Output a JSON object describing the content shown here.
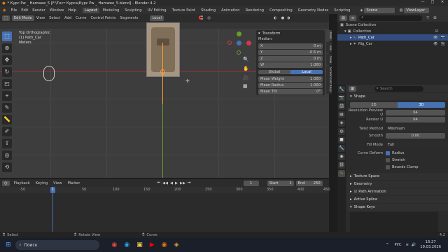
{
  "titlebar": {
    "title": "* Курс Pw _ Hamwee_5 [F:\\Тест Курса\\Курс Pw _ Hamwee_5.blend] - Blender 4.2"
  },
  "menubar": {
    "menus": [
      "File",
      "Edit",
      "Render",
      "Window",
      "Help"
    ],
    "workspaces": [
      "Layout",
      "Modeling",
      "Sculpting",
      "UV Editing",
      "Texture Paint",
      "Shading",
      "Animation",
      "Rendering",
      "Compositing",
      "Geometry Nodes",
      "Scripting"
    ],
    "scene": "Scene",
    "view_layer": "ViewLayer"
  },
  "vheader": {
    "mode": "Edit Mode",
    "menus": [
      "View",
      "Select",
      "Add",
      "Curve",
      "Control Points",
      "Segments"
    ],
    "orientation": "Local"
  },
  "viewport": {
    "view_name": "Top Orthographic",
    "object": "(1) Path_Car",
    "units": "Meters"
  },
  "npanel": {
    "title": "Transform",
    "median_label": "Median:",
    "fields": [
      {
        "label": "X",
        "value": "0 m"
      },
      {
        "label": "Y",
        "value": "-0.5 m"
      },
      {
        "label": "Z",
        "value": "0 m"
      },
      {
        "label": "W",
        "value": "1.000"
      }
    ],
    "global": "Global",
    "local": "Local",
    "extra": [
      {
        "label": "Mean Weight",
        "value": "1.000"
      },
      {
        "label": "Mean Radius",
        "value": "1.000"
      },
      {
        "label": "Mean Tilt",
        "value": "0°"
      }
    ],
    "tabs": [
      "Item",
      "Tool",
      "View",
      "Screencast Keys"
    ]
  },
  "timeline": {
    "menus": [
      "Playback",
      "Keying",
      "View",
      "Marker"
    ],
    "current": "1",
    "start_label": "Start",
    "start": "1",
    "end_label": "End",
    "end": "250",
    "ticks": [
      "-50",
      "0",
      "50",
      "100",
      "150",
      "200",
      "250",
      "300",
      "350",
      "400",
      "450"
    ],
    "cur_frame_label": "1"
  },
  "statusbar": {
    "select": "Select",
    "rotate": "Rotate View",
    "context": "Curve",
    "version": "4.2"
  },
  "taskbar": {
    "search_placeholder": "Поиск",
    "time": "16:27",
    "date": "19.03.2026",
    "lang": "РУС"
  },
  "outliner": {
    "search": "",
    "rows": [
      {
        "label": "Scene Collection",
        "indent": 0,
        "selected": false
      },
      {
        "label": "Collection",
        "indent": 1,
        "selected": false
      },
      {
        "label": "Path_Car",
        "indent": 2,
        "selected": true
      },
      {
        "label": "Rig_Car",
        "indent": 2,
        "selected": false
      }
    ]
  },
  "props": {
    "search_placeholder": "Search",
    "shape_title": "Shape",
    "dim2d": "2D",
    "dim3d": "3D",
    "fields": [
      {
        "label": "Resolution Preview U",
        "value": "64"
      },
      {
        "label": "Render U",
        "value": "64"
      }
    ],
    "twist_label": "Twist Method",
    "twist": "Minimum",
    "smooth_label": "Smooth",
    "smooth": "0.00",
    "fill_label": "Fill Mode",
    "fill": "Full",
    "deform_label": "Curve Deform",
    "radius": "Radius",
    "stretch": "Stretch",
    "bounds": "Bounds Clamp",
    "sections": [
      "Texture Space",
      "Geometry",
      "Path Animation",
      "Active Spline",
      "Shape Keys"
    ]
  },
  "colors": {
    "accent": "#4772b3",
    "x_axis": "#8a2a38",
    "y_axis": "#6a9c2a",
    "selected": "#ff9f2e"
  }
}
